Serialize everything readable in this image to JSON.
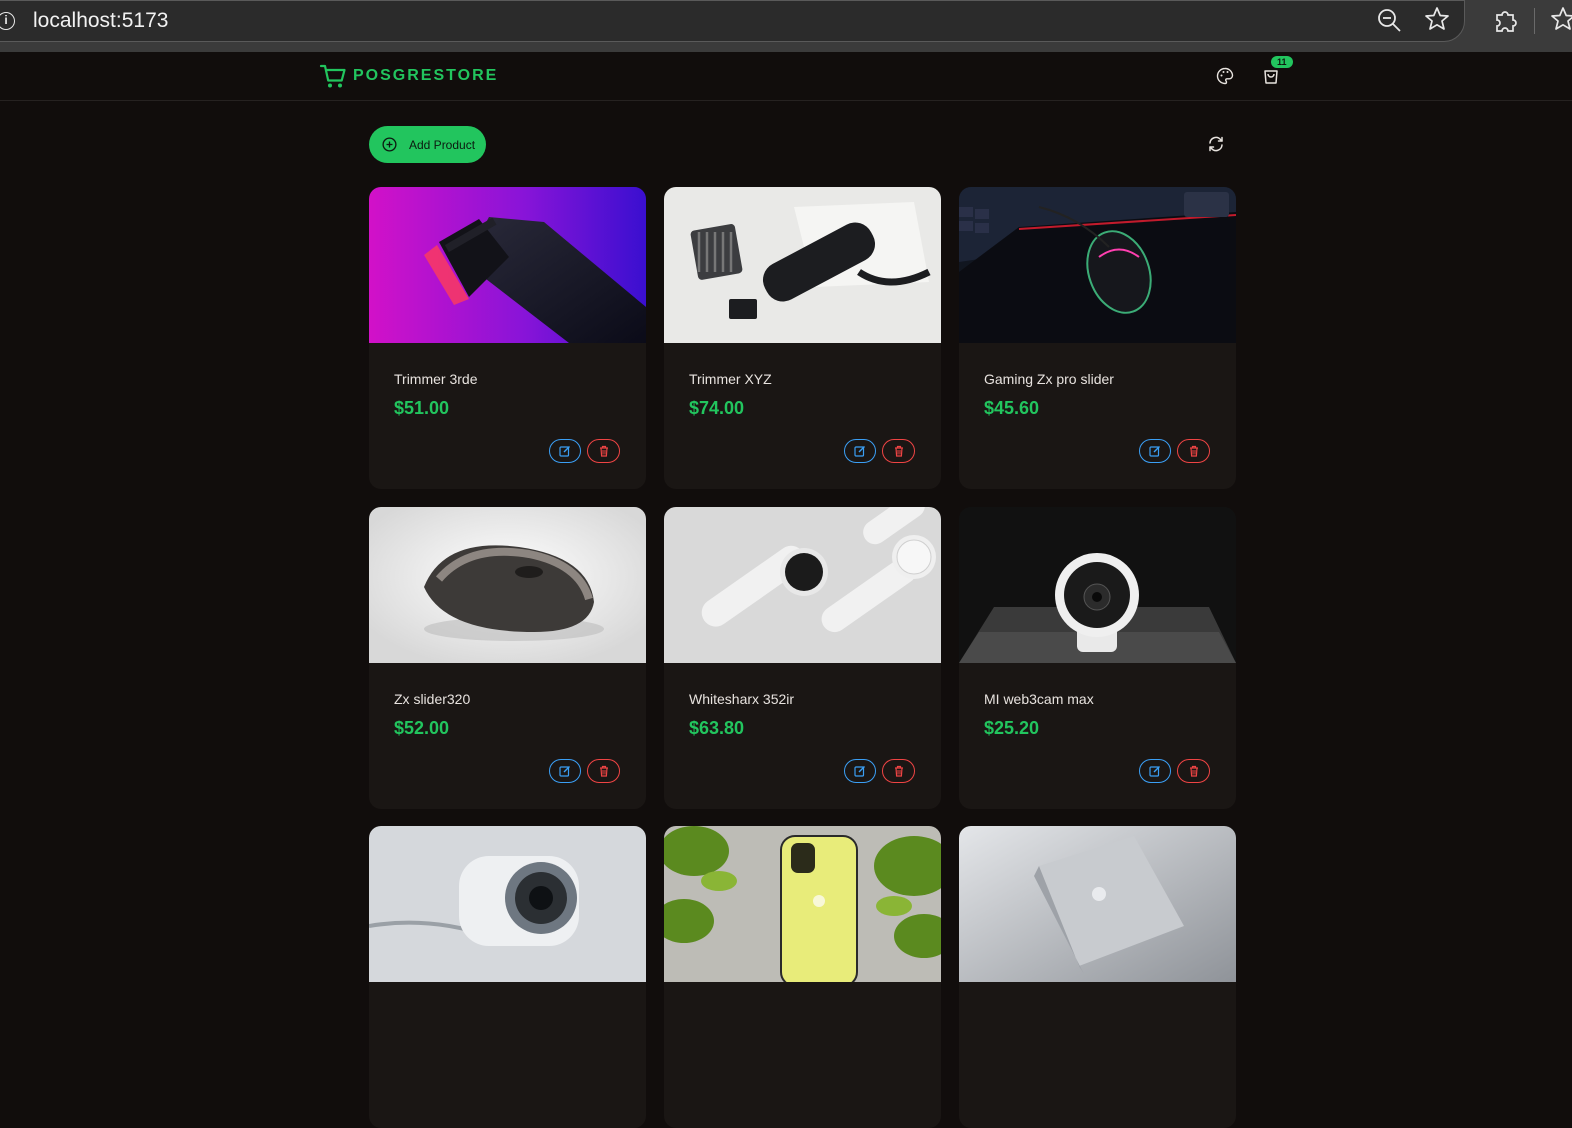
{
  "browser": {
    "url": "localhost:5173"
  },
  "app": {
    "brand": "POSGRESTORE",
    "cart_count": "11",
    "add_product_label": "Add Product"
  },
  "colors": {
    "accent": "#22c55e",
    "edit": "#3b9ff5",
    "delete": "#ef4444",
    "background": "#110d0c",
    "card": "#1a1614"
  },
  "products": [
    {
      "name": "Trimmer 3rde",
      "price": "$51.00"
    },
    {
      "name": "Trimmer XYZ",
      "price": "$74.00"
    },
    {
      "name": "Gaming Zx pro slider",
      "price": "$45.60"
    },
    {
      "name": "Zx slider320",
      "price": "$52.00"
    },
    {
      "name": "Whitesharx 352ir",
      "price": "$63.80"
    },
    {
      "name": "MI web3cam max",
      "price": "$25.20"
    }
  ]
}
